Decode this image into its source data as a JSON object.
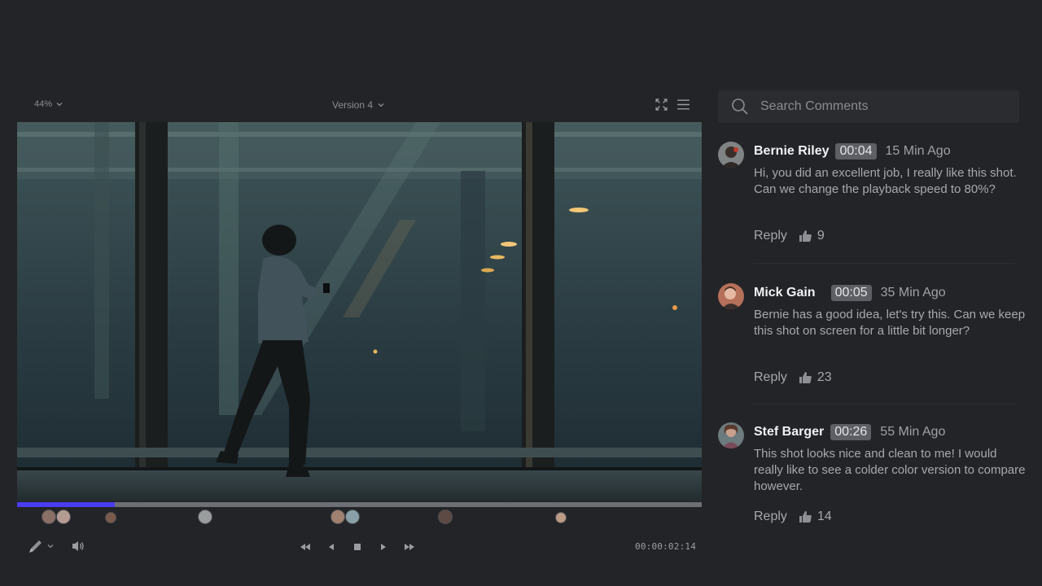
{
  "player": {
    "zoom": "44%",
    "version": "Version 4",
    "progress_fraction": 0.143,
    "timecode": "00:00:02:14"
  },
  "search": {
    "placeholder": "Search Comments"
  },
  "comments": [
    {
      "name": "Bernie Riley",
      "time": "00:04",
      "ago": "15 Min Ago",
      "text": "Hi, you did an excellent job, I really like this shot. Can we change the playback speed to 80%?",
      "reply": "Reply",
      "likes": "9"
    },
    {
      "name": "Mick Gain",
      "time": "00:05",
      "ago": "35 Min Ago",
      "text": "Bernie has a good idea, let's try this. Can we keep this shot on screen for a little bit longer?",
      "reply": "Reply",
      "likes": "23"
    },
    {
      "name": "Stef Barger",
      "time": "00:26",
      "ago": "55 Min Ago",
      "text": "This shot looks nice and clean to me! I would really like to see a colder color version to compare however.",
      "reply": "Reply",
      "likes": "14"
    }
  ],
  "colors": {
    "background": "#232427",
    "accent": "#4a3cf0",
    "timecode_chip": "#5d5f64"
  },
  "icons": [
    "chevron-down-icon",
    "fullscreen-icon",
    "menu-icon",
    "search-icon",
    "pen-icon",
    "volume-icon",
    "rewind-icon",
    "step-back-icon",
    "stop-icon",
    "play-icon",
    "fast-forward-icon",
    "thumbs-up-icon"
  ]
}
